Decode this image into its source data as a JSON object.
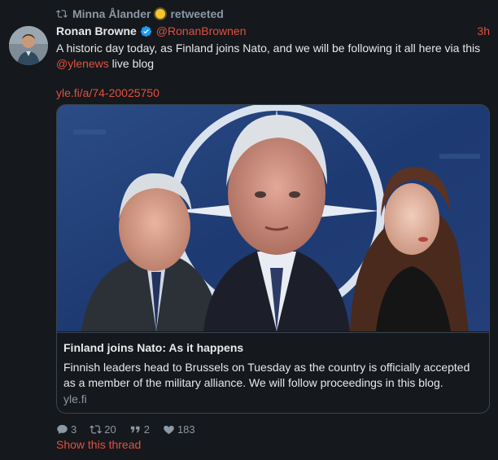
{
  "retweet": {
    "user": "Minna Ålander",
    "label": "retweeted"
  },
  "author": {
    "name": "Ronan Browne",
    "handle": "@RonanBrownen",
    "time": "3h"
  },
  "tweet": {
    "text_before": "A historic day today, as Finland joins Nato, and we will be following it all here via this ",
    "mention": "@ylenews",
    "text_after": " live blog",
    "link": "yle.fi/a/74-20025750"
  },
  "card": {
    "title": "Finland joins Nato: As it happens",
    "description": "Finnish leaders head to Brussels on Tuesday as the country is officially accepted as a member of the military alliance. We will follow proceedings in this blog.",
    "domain": "yle.fi"
  },
  "stats": {
    "replies": "3",
    "retweets": "20",
    "quotes": "2",
    "likes": "183"
  },
  "show_thread": "Show this thread",
  "colors": {
    "accent": "#e0523f",
    "background": "#15181c",
    "muted": "#8b98a5",
    "verified": "#1d9bf0"
  }
}
